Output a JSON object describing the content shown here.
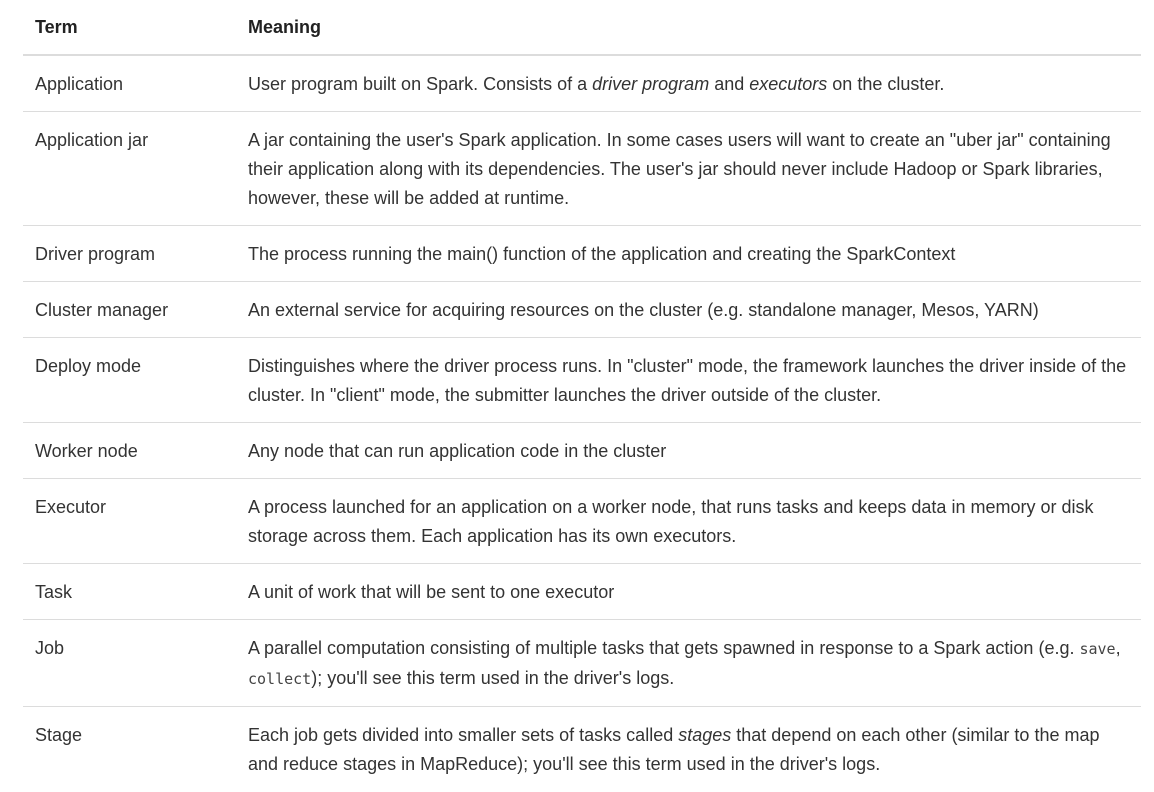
{
  "table": {
    "headers": {
      "term": "Term",
      "meaning": "Meaning"
    },
    "rows": [
      {
        "term": "Application",
        "meaning": [
          {
            "text": "User program built on Spark. Consists of a "
          },
          {
            "text": "driver program",
            "style": "em"
          },
          {
            "text": " and "
          },
          {
            "text": "executors",
            "style": "em"
          },
          {
            "text": " on the cluster."
          }
        ]
      },
      {
        "term": "Application jar",
        "meaning": [
          {
            "text": "A jar containing the user's Spark application. In some cases users will want to create an \"uber jar\" containing their application along with its dependencies. The user's jar should never include Hadoop or Spark libraries, however, these will be added at runtime."
          }
        ]
      },
      {
        "term": "Driver program",
        "meaning": [
          {
            "text": "The process running the main() function of the application and creating the SparkContext"
          }
        ]
      },
      {
        "term": "Cluster manager",
        "meaning": [
          {
            "text": "An external service for acquiring resources on the cluster (e.g. standalone manager, Mesos, YARN)"
          }
        ]
      },
      {
        "term": "Deploy mode",
        "meaning": [
          {
            "text": "Distinguishes where the driver process runs. In \"cluster\" mode, the framework launches the driver inside of the cluster. In \"client\" mode, the submitter launches the driver outside of the cluster."
          }
        ]
      },
      {
        "term": "Worker node",
        "meaning": [
          {
            "text": "Any node that can run application code in the cluster"
          }
        ]
      },
      {
        "term": "Executor",
        "meaning": [
          {
            "text": "A process launched for an application on a worker node, that runs tasks and keeps data in memory or disk storage across them. Each application has its own executors."
          }
        ]
      },
      {
        "term": "Task",
        "meaning": [
          {
            "text": "A unit of work that will be sent to one executor"
          }
        ]
      },
      {
        "term": "Job",
        "meaning": [
          {
            "text": "A parallel computation consisting of multiple tasks that gets spawned in response to a Spark action (e.g. "
          },
          {
            "text": "save",
            "style": "code"
          },
          {
            "text": ", "
          },
          {
            "text": "collect",
            "style": "code"
          },
          {
            "text": "); you'll see this term used in the driver's logs."
          }
        ]
      },
      {
        "term": "Stage",
        "meaning": [
          {
            "text": "Each job gets divided into smaller sets of tasks called "
          },
          {
            "text": "stages",
            "style": "em"
          },
          {
            "text": " that depend on each other (similar to the map and reduce stages in MapReduce); you'll see this term used in the driver's logs."
          }
        ]
      }
    ]
  }
}
